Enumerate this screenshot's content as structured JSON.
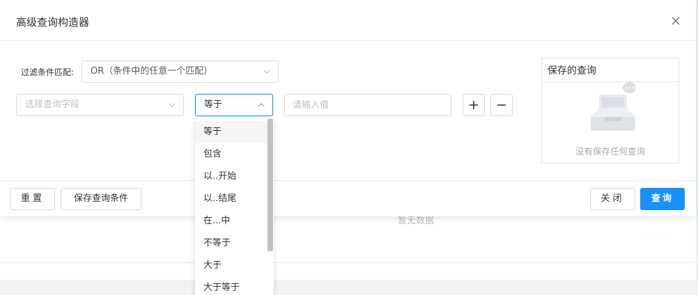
{
  "modal": {
    "title": "高级查询构造器",
    "filter_label": "过滤条件匹配:",
    "match_select": {
      "value": "OR（条件中的任意一个匹配）"
    },
    "field_select": {
      "placeholder": "选择查询字段"
    },
    "operator_select": {
      "value": "等于"
    },
    "value_input": {
      "placeholder": "请输入值",
      "value": ""
    },
    "saved_panel": {
      "title": "保存的查询",
      "empty_text": "没有保存任何查询"
    },
    "footer": {
      "reset_label": "重置",
      "save_condition_label": "保存查询条件",
      "close_label": "关闭",
      "query_label": "查询"
    }
  },
  "operator_dropdown": {
    "options": [
      "等于",
      "包含",
      "以..开始",
      "以..结尾",
      "在...中",
      "不等于",
      "大于",
      "大于等于"
    ],
    "selected_index": 0
  },
  "background": {
    "empty_text": "暂无数据"
  },
  "colors": {
    "primary": "#1890ff",
    "border": "#d9d9d9",
    "placeholder": "#bfbfbf"
  },
  "icons": [
    "close-icon",
    "chevron-down-icon",
    "chevron-up-icon",
    "plus-icon",
    "minus-icon",
    "empty-inbox-icon"
  ]
}
